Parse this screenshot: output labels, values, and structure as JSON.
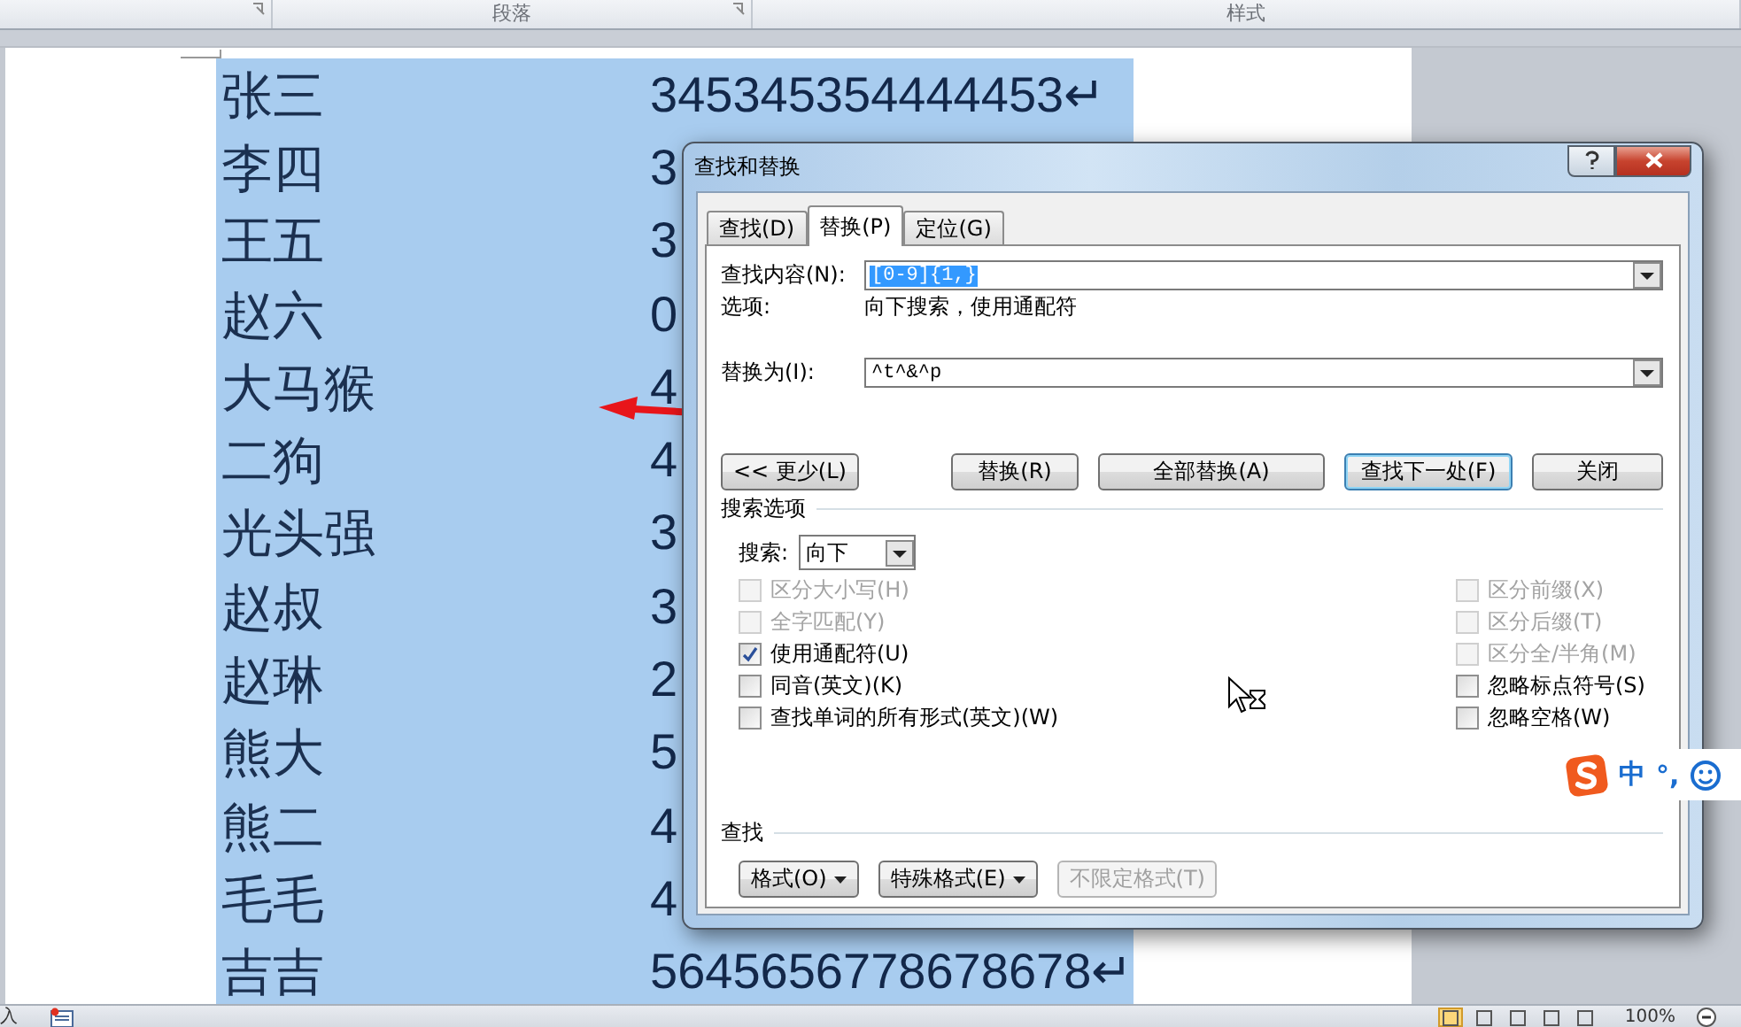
{
  "ribbon": {
    "groups": [
      {
        "label": "段落"
      },
      {
        "label": "样式"
      }
    ]
  },
  "document": {
    "rows": [
      {
        "name": "张三",
        "number": "345345354444453↵"
      },
      {
        "name": "李四",
        "number": "3"
      },
      {
        "name": "王五",
        "number": "3"
      },
      {
        "name": "赵六",
        "number": "0"
      },
      {
        "name": "大马猴",
        "number": "4"
      },
      {
        "name": "二狗",
        "number": "4"
      },
      {
        "name": "光头强",
        "number": "3"
      },
      {
        "name": "赵叔",
        "number": "3"
      },
      {
        "name": "赵琳",
        "number": "2"
      },
      {
        "name": "熊大",
        "number": "5"
      },
      {
        "name": "熊二",
        "number": "4"
      },
      {
        "name": "毛毛",
        "number": "4"
      },
      {
        "name": "吉吉",
        "number": "5645656778678678↵"
      }
    ]
  },
  "dialog": {
    "title": "查找和替换",
    "tabs": [
      {
        "label": "查找(D)",
        "selected": false
      },
      {
        "label": "替换(P)",
        "selected": true
      },
      {
        "label": "定位(G)",
        "selected": false
      }
    ],
    "find": {
      "label": "查找内容(N):",
      "value": "[0-9]{1,}"
    },
    "options": {
      "label": "选项:",
      "value": "向下搜索，使用通配符"
    },
    "replace": {
      "label": "替换为(I):",
      "value": "^t^&^p"
    },
    "buttons": [
      {
        "label": "<< 更少(L)",
        "default": false
      },
      {
        "label": "替换(R)",
        "default": false
      },
      {
        "label": "全部替换(A)",
        "default": false
      },
      {
        "label": "查找下一处(F)",
        "default": true
      },
      {
        "label": "关闭",
        "default": false
      }
    ],
    "search_options": {
      "title": "搜索选项",
      "search_label": "搜索:",
      "search_value": "向下",
      "left": [
        {
          "label": "区分大小写(H)",
          "checked": false,
          "disabled": true
        },
        {
          "label": "全字匹配(Y)",
          "checked": false,
          "disabled": true
        },
        {
          "label": "使用通配符(U)",
          "checked": true,
          "disabled": false
        },
        {
          "label": "同音(英文)(K)",
          "checked": false,
          "disabled": false
        },
        {
          "label": "查找单词的所有形式(英文)(W)",
          "checked": false,
          "disabled": false
        }
      ],
      "right": [
        {
          "label": "区分前缀(X)",
          "checked": false,
          "disabled": true
        },
        {
          "label": "区分后缀(T)",
          "checked": false,
          "disabled": true
        },
        {
          "label": "区分全/半角(M)",
          "checked": false,
          "disabled": true
        },
        {
          "label": "忽略标点符号(S)",
          "checked": false,
          "disabled": false
        },
        {
          "label": "忽略空格(W)",
          "checked": false,
          "disabled": false
        }
      ]
    },
    "find_section": {
      "title": "查找",
      "buttons": [
        {
          "label": "格式(O)",
          "dropdown": true,
          "disabled": false
        },
        {
          "label": "特殊格式(E)",
          "dropdown": true,
          "disabled": false
        },
        {
          "label": "不限定格式(T)",
          "dropdown": false,
          "disabled": true
        }
      ]
    }
  },
  "ime": {
    "labels": [
      "中",
      "°,"
    ]
  },
  "status_bar": {
    "mode": "入",
    "zoom": "100%"
  }
}
